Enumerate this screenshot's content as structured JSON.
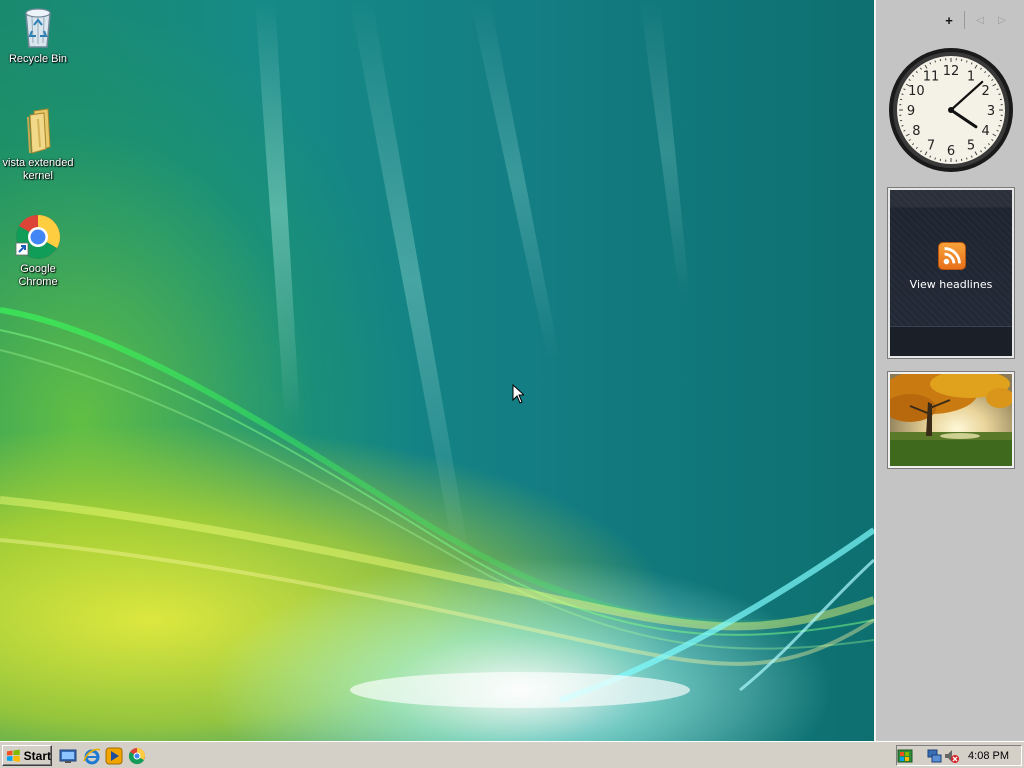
{
  "desktop": {
    "icons": [
      {
        "label": "Recycle Bin",
        "icon": "recycle-bin-icon"
      },
      {
        "label": "vista extended kernel",
        "icon": "folder-icon"
      },
      {
        "label": "Google Chrome",
        "icon": "chrome-icon"
      }
    ]
  },
  "sidebar": {
    "controls": {
      "add": "+",
      "prev": "◁",
      "next": "▷"
    },
    "clock": {
      "numerals": [
        "12",
        "1",
        "2",
        "3",
        "4",
        "5",
        "6",
        "7",
        "8",
        "9",
        "10",
        "11"
      ],
      "hour": 4,
      "minute": 8
    },
    "feed": {
      "label": "View headlines",
      "icon": "rss-icon"
    },
    "slideshow": {
      "icon": "autumn-tree-photo"
    }
  },
  "taskbar": {
    "start_label": "Start",
    "quick_launch": [
      "show-desktop-icon",
      "internet-explorer-icon",
      "media-player-icon",
      "chrome-icon"
    ],
    "tray": {
      "time": "4:08 PM",
      "icons": [
        "network-icon",
        "volume-muted-icon",
        "security-center-icon"
      ]
    }
  },
  "colors": {
    "taskbar": "#d4d0c8",
    "sidebar": "#c4c4c4",
    "feed_bg": "#242b38",
    "rss": "#f08a2a"
  }
}
